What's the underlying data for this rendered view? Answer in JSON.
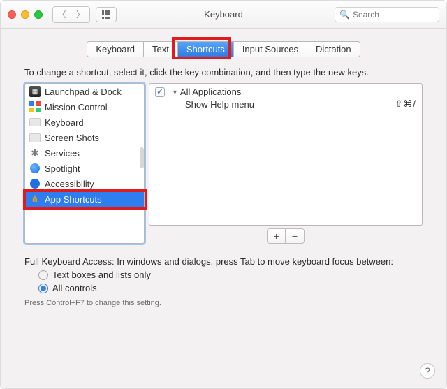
{
  "header": {
    "title": "Keyboard"
  },
  "search": {
    "placeholder": "Search"
  },
  "tabs": [
    "Keyboard",
    "Text",
    "Shortcuts",
    "Input Sources",
    "Dictation"
  ],
  "active_tab_index": 2,
  "instruction": "To change a shortcut, select it, click the key combination, and then type the new keys.",
  "categories": [
    {
      "label": "Launchpad & Dock",
      "icon": "launchpad"
    },
    {
      "label": "Mission Control",
      "icon": "mission"
    },
    {
      "label": "Keyboard",
      "icon": "keyboard"
    },
    {
      "label": "Screen Shots",
      "icon": "screen"
    },
    {
      "label": "Services",
      "icon": "services"
    },
    {
      "label": "Spotlight",
      "icon": "spotlight"
    },
    {
      "label": "Accessibility",
      "icon": "access"
    },
    {
      "label": "App Shortcuts",
      "icon": "appsc"
    }
  ],
  "selected_category_index": 7,
  "detail": {
    "group": "All Applications",
    "items": [
      {
        "checked": true,
        "label": "Show Help menu",
        "shortcut": "⇧⌘/"
      }
    ]
  },
  "footer": {
    "heading": "Full Keyboard Access: In windows and dialogs, press Tab to move keyboard focus between:",
    "options": [
      "Text boxes and lists only",
      "All controls"
    ],
    "selected_option_index": 1,
    "note": "Press Control+F7 to change this setting."
  },
  "annotations": {
    "highlight_tab": true,
    "highlight_category": true
  }
}
